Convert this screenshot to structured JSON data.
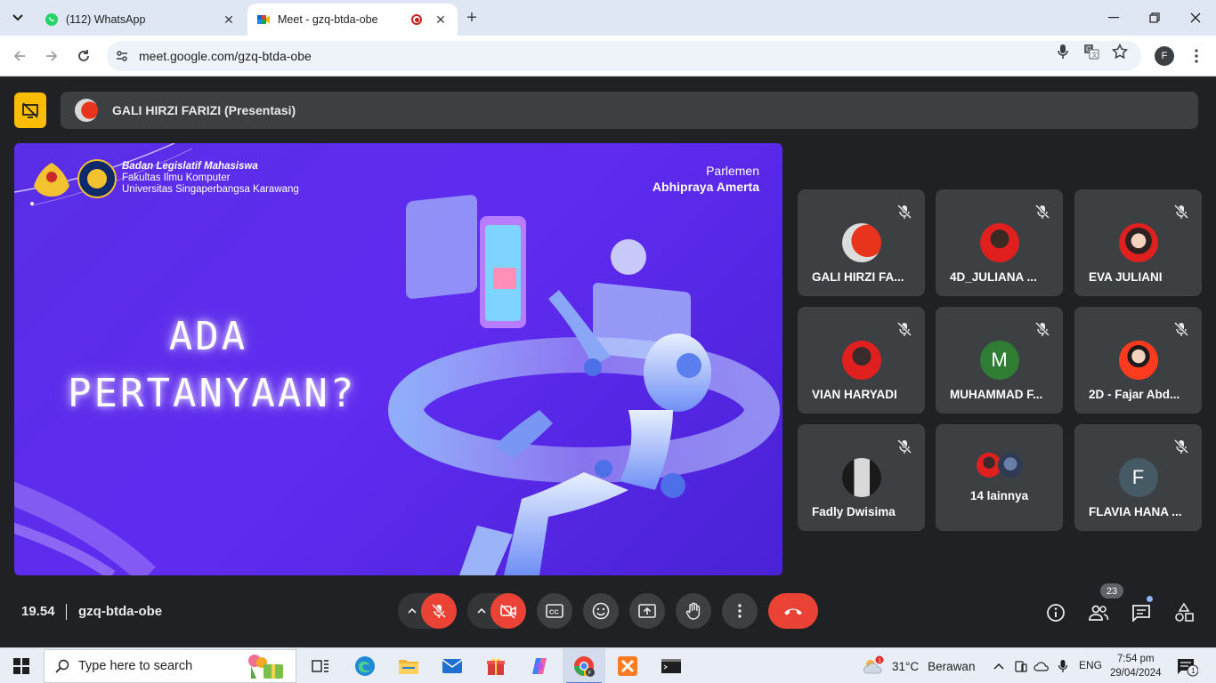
{
  "browser": {
    "tabs": [
      {
        "title": "(112) WhatsApp",
        "active": false,
        "favicon": "whatsapp-icon"
      },
      {
        "title": "Meet - gzq-btda-obe",
        "active": true,
        "favicon": "google-meet-icon",
        "recording": true
      }
    ],
    "url": "meet.google.com/gzq-btda-obe",
    "profile_initial": "F"
  },
  "meet": {
    "presenter_label": "GALI HIRZI FARIZI (Presentasi)",
    "slide": {
      "org_line1": "Badan Legislatif Mahasiswa",
      "org_line2": "Fakultas Ilmu Komputer",
      "org_line3": "Universitas Singaperbangsa Karawang",
      "parlemen": "Parlemen",
      "cabinet": "Abhipraya Amerta",
      "headline_line1": "ADA",
      "headline_line2": "PERTANYAAN?"
    },
    "participants": [
      {
        "name": "GALI HIRZI FA...",
        "avatar": "photo",
        "muted": true
      },
      {
        "name": "4D_JULIANA ...",
        "avatar": "photo",
        "muted": true
      },
      {
        "name": "EVA JULIANI",
        "avatar": "photo",
        "muted": true
      },
      {
        "name": "VIAN HARYADI",
        "avatar": "photo",
        "muted": true
      },
      {
        "name": "MUHAMMAD F...",
        "avatar": "initial",
        "initial": "M",
        "muted": true
      },
      {
        "name": "2D - Fajar Abd...",
        "avatar": "photo",
        "muted": true
      },
      {
        "name": "Fadly Dwisima",
        "avatar": "photo",
        "muted": true
      },
      {
        "name": "14 lainnya",
        "avatar": "group",
        "muted": false
      },
      {
        "name": "FLAVIA HANA ...",
        "avatar": "initial",
        "initial": "F",
        "muted": true
      }
    ],
    "time": "19.54",
    "meeting_code": "gzq-btda-obe",
    "participant_count": "23",
    "colors": {
      "accent_red": "#ea4335",
      "present_yellow": "#fbbc04",
      "surface": "#3c4043",
      "background": "#202124",
      "slide_purple": "#5a2ee6"
    }
  },
  "taskbar": {
    "search_placeholder": "Type here to search",
    "weather_temp": "31°C",
    "weather_text": "Berawan",
    "weather_badge": "1",
    "language": "ENG",
    "time": "7:54 pm",
    "date": "29/04/2024",
    "notification_count": "1"
  }
}
